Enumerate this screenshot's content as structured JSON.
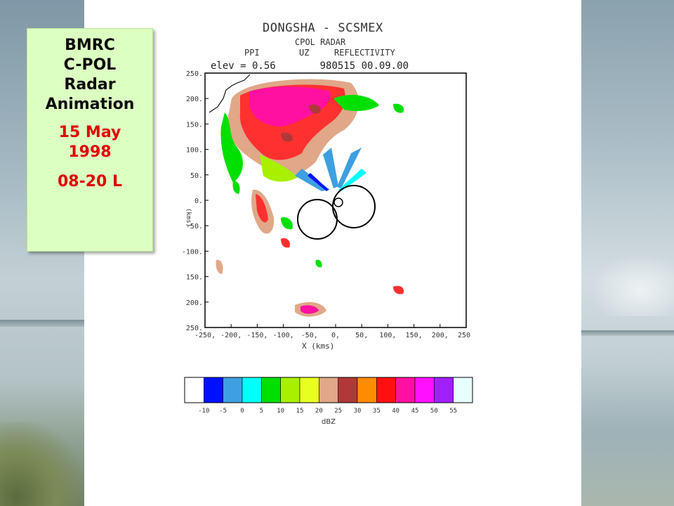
{
  "title_box": {
    "lines": [
      "BMRC",
      "C-POL",
      "Radar",
      "Animation"
    ],
    "date_lines": [
      "15 May",
      "1998"
    ],
    "time": "08-20 L"
  },
  "radar": {
    "title": "DONGSHA - SCSMEX",
    "subtitle": "CPOL RADAR",
    "product": [
      "PPI",
      "UZ",
      "REFLECTIVITY"
    ],
    "elev_label": "elev = 0.56",
    "datetime": "980515 00.09.00",
    "x_label": "X (kms)",
    "y_label": "(kms)",
    "x_ticks": [
      "-250",
      "-200",
      "-150",
      "-100",
      "-50",
      "0",
      "50",
      "100",
      "150",
      "200",
      "250"
    ],
    "y_ticks": [
      "250",
      "200",
      "150",
      "100",
      "50",
      "0",
      "-50",
      "-100",
      "150",
      "200",
      "250"
    ],
    "colorbar": {
      "unit": "dBZ",
      "labels": [
        "-10",
        "-5",
        "0",
        "5",
        "10",
        "15",
        "20",
        "25",
        "30",
        "35",
        "40",
        "45",
        "50",
        "55"
      ],
      "colors": [
        "#ffffff",
        "#0010ff",
        "#3ea0e0",
        "#00ffff",
        "#00e000",
        "#a8f000",
        "#e8ff20",
        "#e0a888",
        "#b03838",
        "#ff8c00",
        "#ff1010",
        "#ff10a0",
        "#ff10ff",
        "#a020ff",
        "#e8ffff"
      ]
    }
  },
  "colors": {
    "title_bg": "#dcffc2",
    "title_text": "#0c0c0c",
    "accent_red": "#e10000"
  }
}
